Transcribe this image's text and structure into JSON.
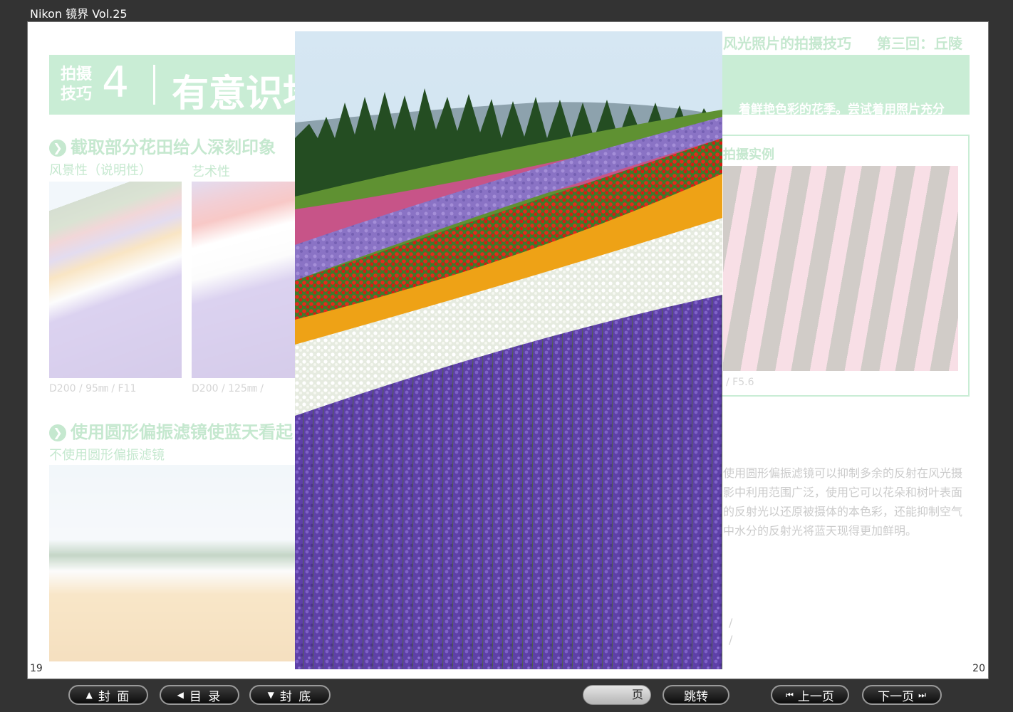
{
  "app": {
    "title": "Nikon 镜界 Vol.25"
  },
  "page_left": {
    "banner_small": "拍摄技巧",
    "banner_number": "4",
    "banner_heading": "有意识地",
    "section1_heading": "截取部分花田给人深刻印象",
    "label_a": "风景性（说明性）",
    "label_b": "艺术性",
    "caption_a": "D200 / 95㎜ / F11",
    "caption_b": "D200 / 125㎜ /",
    "section2_heading": "使用圆形偏振滤镜使蓝天看起",
    "label_c": "不使用圆形偏振滤镜",
    "page_number": "19"
  },
  "page_right": {
    "series_title": "风光照片的拍摄技巧",
    "series_episode": "第三回：丘陵",
    "banner_desc": "着鲜艳色彩的花季。尝试着用照片充分",
    "example_label": "拍摄实例",
    "caption_d": "/ F5.6",
    "paragraph": "使用圆形偏振滤镜可以抑制多余的反射在风光摄影中利用范围广泛，使用它可以花朵和树叶表面的反射光以还原被摄体的本色彩，还能抑制空气中水分的反射光将蓝天现得更加鲜明。",
    "slash1": "/",
    "slash2": "/",
    "page_number": "20"
  },
  "colors": {
    "accent_green": "#3fbf68",
    "toolbar_bg": "#333333"
  },
  "toolbar": {
    "cover": "封 面",
    "toc": "目 录",
    "back_cover": "封 底",
    "page_suffix": "页",
    "jump": "跳转",
    "prev": "上一页",
    "next": "下一页"
  },
  "icons": {
    "cover": "triangle-up-icon",
    "toc": "triangle-left-icon",
    "back_cover": "triangle-down-icon",
    "prev": "skip-back-icon",
    "next": "skip-forward-icon"
  }
}
